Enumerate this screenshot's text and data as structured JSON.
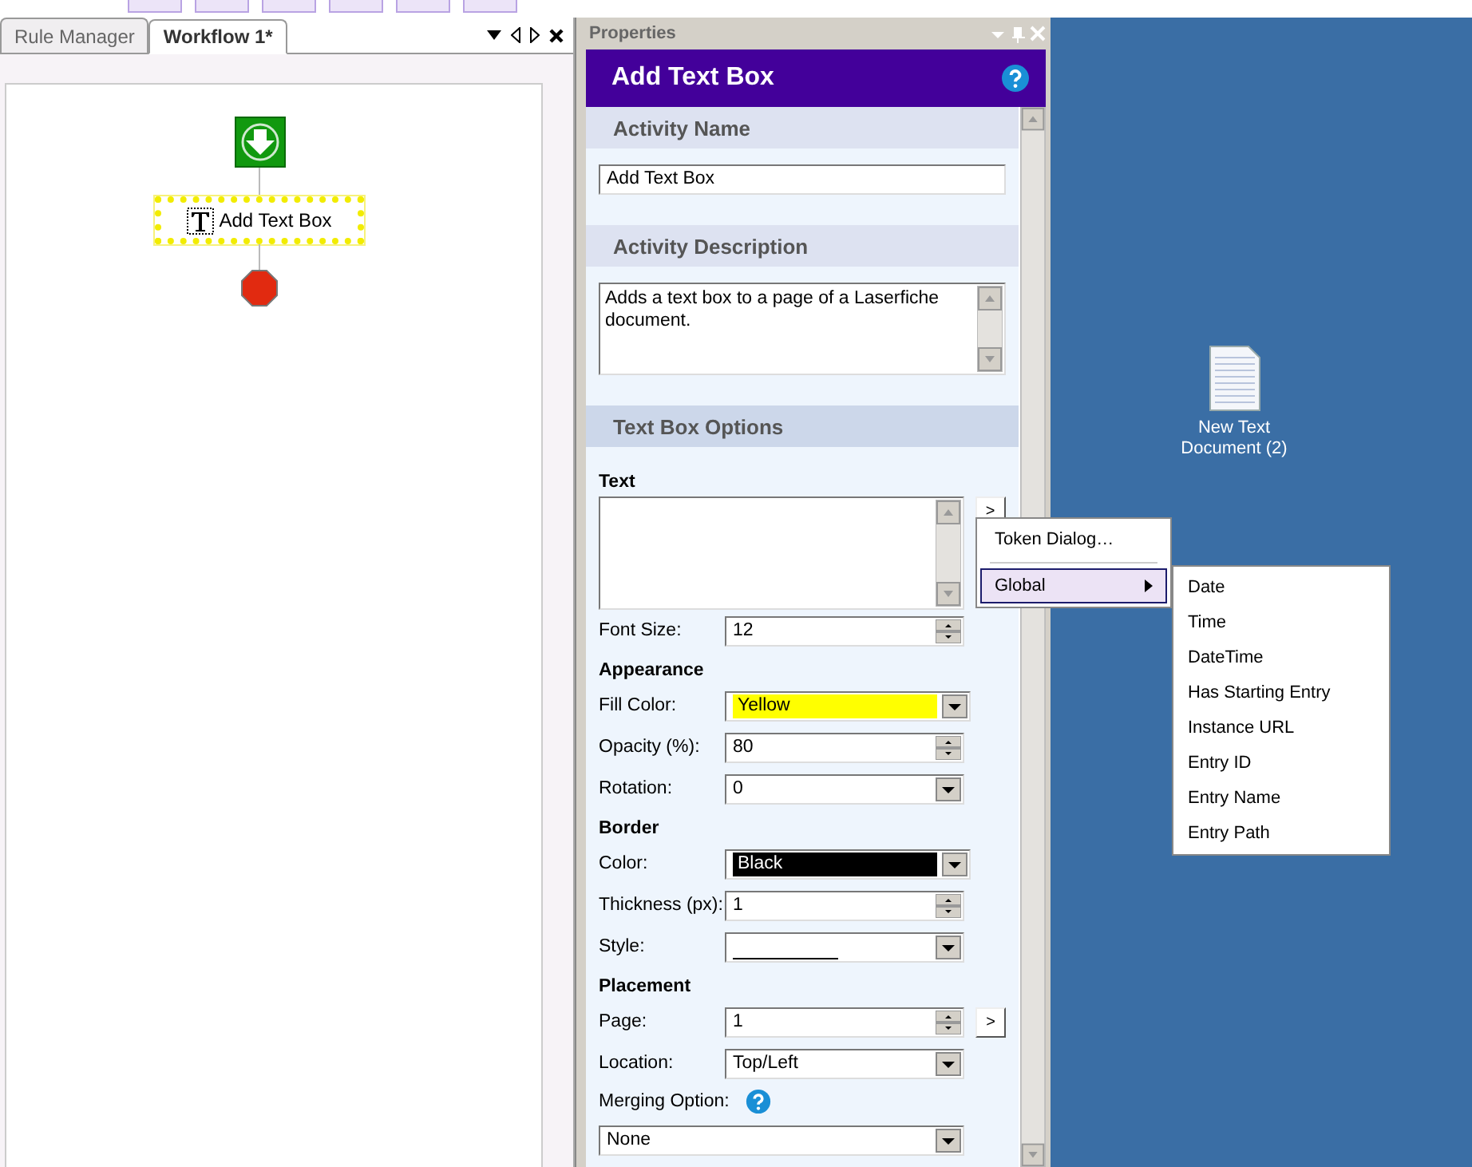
{
  "tabs": [
    {
      "label": "Rule Manager",
      "selected": false
    },
    {
      "label": "Workflow 1*",
      "selected": true
    }
  ],
  "workflow": {
    "nodes": [
      {
        "kind": "start"
      },
      {
        "kind": "activity",
        "label": "Add Text Box",
        "selected": true
      },
      {
        "kind": "end"
      }
    ]
  },
  "properties": {
    "panel_title": "Properties",
    "title": "Add Text Box",
    "sections": [
      {
        "heading": "Activity Name",
        "rows": [
          {
            "kind": "text",
            "value": "Add Text Box"
          }
        ]
      },
      {
        "heading": "Activity Description",
        "rows": [
          {
            "kind": "memo",
            "value": "Adds a text box to a page of a Laserfiche document."
          }
        ]
      },
      {
        "heading": "Text Box Options",
        "rows": [
          {
            "kind": "subheading",
            "label": "Text"
          },
          {
            "kind": "memo",
            "button": ">"
          },
          {
            "kind": "spin",
            "label": "Font Size:",
            "value": "12"
          },
          {
            "kind": "subheading",
            "label": "Appearance"
          },
          {
            "kind": "combo",
            "label": "Fill Color:",
            "value": "Yellow",
            "color": "#ffff00"
          },
          {
            "kind": "spin",
            "label": "Opacity (%):",
            "value": "80"
          },
          {
            "kind": "combo",
            "label": "Rotation:",
            "value": "0"
          },
          {
            "kind": "subheading",
            "label": "Border"
          },
          {
            "kind": "combo",
            "label": "Color:",
            "value": "Black",
            "color": "#000000"
          },
          {
            "kind": "spin",
            "label": "Thickness (px):",
            "value": "1"
          },
          {
            "kind": "linestyle",
            "label": "Style:"
          },
          {
            "kind": "subheading",
            "label": "Placement"
          },
          {
            "kind": "spin",
            "label": "Page:",
            "value": "1",
            "button": ">"
          },
          {
            "kind": "combo",
            "label": "Location:",
            "value": "Top/Left"
          },
          {
            "kind": "label",
            "label": "Merging Option:",
            "help": true
          },
          {
            "kind": "combo",
            "value": "None"
          }
        ]
      }
    ]
  },
  "token_menu": {
    "items": [
      {
        "label": "Token Dialog…",
        "selected": false,
        "submenu": false
      },
      {
        "label": "Global",
        "selected": true,
        "submenu": true
      }
    ]
  },
  "submenu": {
    "items": [
      "Date",
      "Time",
      "DateTime",
      "Has Starting Entry",
      "Instance URL",
      "Entry ID",
      "Entry Name",
      "Entry Path"
    ]
  },
  "desktop": {
    "icons": [
      {
        "label": "New Text Document (2)"
      }
    ]
  }
}
